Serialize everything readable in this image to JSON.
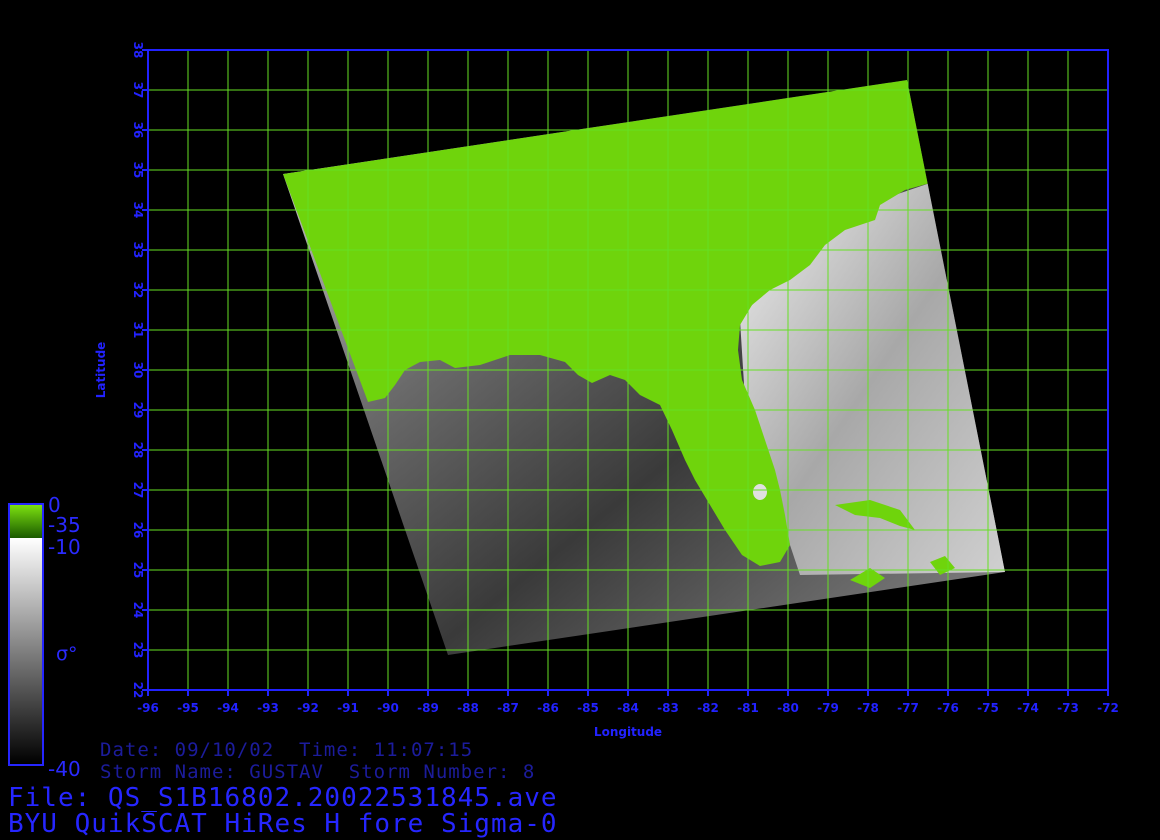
{
  "map": {
    "lon_range": [
      -96,
      -72
    ],
    "lat_range": [
      22,
      38
    ],
    "lon_ticks": [
      "-96",
      "-95",
      "-94",
      "-93",
      "-92",
      "-91",
      "-90",
      "-89",
      "-88",
      "-87",
      "-86",
      "-85",
      "-84",
      "-83",
      "-82",
      "-81",
      "-80",
      "-79",
      "-78",
      "-77",
      "-76",
      "-75",
      "-74",
      "-73",
      "-72"
    ],
    "lat_ticks": [
      "22",
      "23",
      "24",
      "25",
      "26",
      "27",
      "28",
      "29",
      "30",
      "31",
      "32",
      "33",
      "34",
      "35",
      "36",
      "37",
      "38"
    ],
    "xlabel": "Longitude",
    "ylabel": "Latitude",
    "grid": true,
    "colors": {
      "axis": "#2222ff",
      "grid": "#66e024",
      "land": "#6fd40c",
      "background": "#000000"
    }
  },
  "colorbar": {
    "land_top": "0",
    "land_bottom": "-35",
    "ocean_top": "-10",
    "ocean_bottom": "-40",
    "symbol": "σ°"
  },
  "info": {
    "date_line": "Date: 09/10/02  Time: 11:07:15",
    "storm_line": "Storm Name: GUSTAV  Storm Number: 8",
    "file_line": "File: QS_S1B16802.20022531845.ave",
    "product_line": "BYU QuikSCAT HiRes H fore Sigma-0"
  }
}
